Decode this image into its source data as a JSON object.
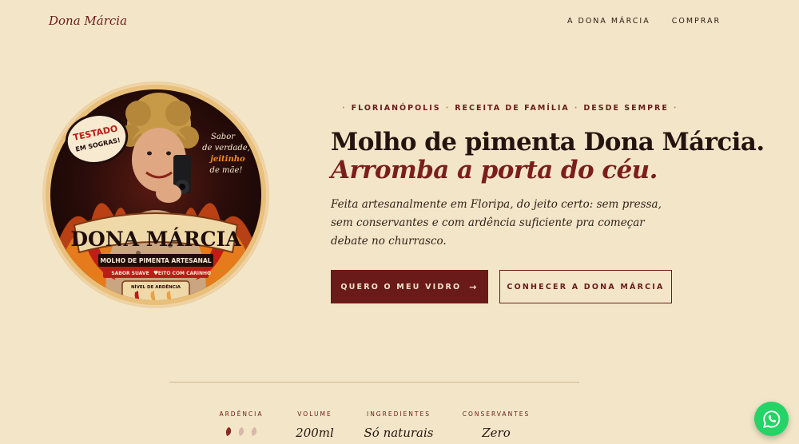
{
  "nav": {
    "brand": "Dona Márcia",
    "links": [
      {
        "label": "A DONA MÁRCIA"
      },
      {
        "label": "COMPRAR"
      }
    ]
  },
  "logo": {
    "badge_line1": "TESTADO",
    "badge_line2": "EM SOGRAS!",
    "script_line1": "Sabor",
    "script_line2": "de verdade,",
    "script_line3": "jeitinho",
    "script_line4": "de mãe!",
    "banner_title": "DONA MÁRCIA",
    "subtitle": "MOLHO DE PIMENTA ARTESANAL",
    "tagline_left": "SABOR SUAVE",
    "tagline_right": "FEITO COM CARINHO",
    "heat_label": "NÍVEL DE ARDÊNCIA"
  },
  "hero": {
    "eyebrow": [
      "FLORIANÓPOLIS",
      "RECEITA DE FAMÍLIA",
      "DESDE SEMPRE"
    ],
    "eyebrow_bullet": "·",
    "headline": "Molho de pimenta Dona Márcia.",
    "headline_accent": "Arromba a porta do céu.",
    "lead": "Feita artesanalmente em Floripa, do jeito certo: sem pressa, sem conservantes e com ardência suficiente pra começar debate no churrasco.",
    "cta_primary": "QUERO O MEU VIDRO",
    "cta_primary_icon": "arrow-right-icon",
    "cta_secondary": "CONHECER A DONA MÁRCIA"
  },
  "stats": [
    {
      "label": "ARDÊNCIA",
      "level": 1,
      "max": 3
    },
    {
      "label": "VOLUME",
      "value": "200ml"
    },
    {
      "label": "INGREDIENTES",
      "value": "Só naturais"
    },
    {
      "label": "CONSERVANTES",
      "value": "Zero"
    }
  ],
  "colors": {
    "background": "#f3e6c8",
    "accent": "#6b1a1a",
    "whatsapp": "#25d366"
  },
  "floating": {
    "icon": "whatsapp-icon"
  }
}
